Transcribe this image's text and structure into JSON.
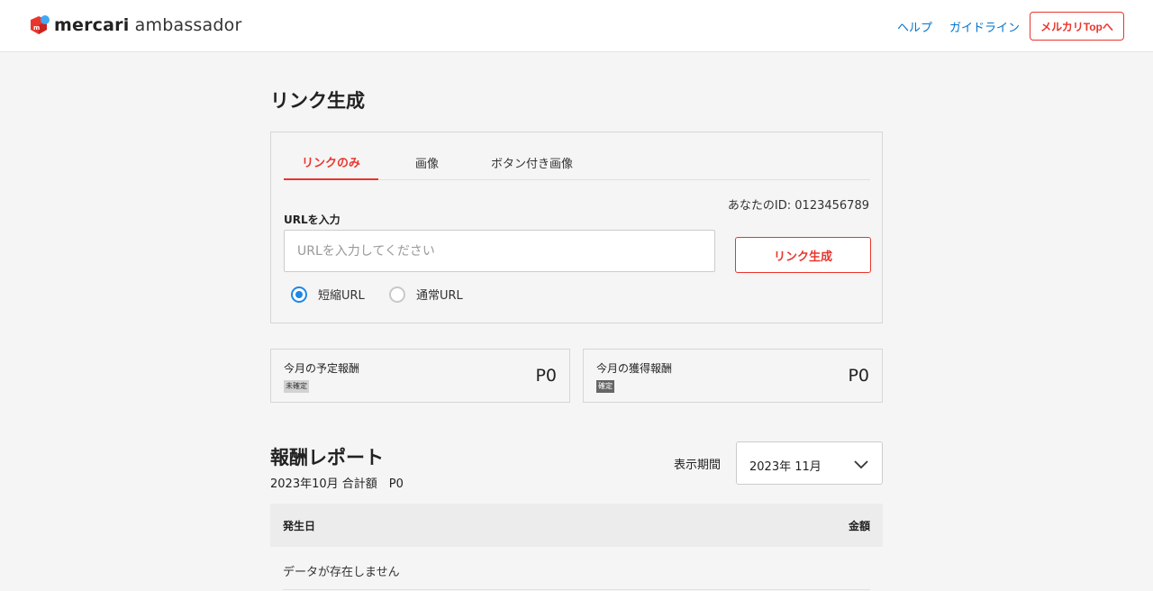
{
  "header": {
    "logo_bold": "mercari",
    "logo_light": "ambassador",
    "nav_help": "ヘルプ",
    "nav_guideline": "ガイドライン",
    "top_button": "メルカリTopへ",
    "brand_color": "#ea352d",
    "link_color": "#0073cc"
  },
  "page_title": "リンク生成",
  "link_panel": {
    "tabs": [
      {
        "label": "リンクのみ",
        "active": true
      },
      {
        "label": "画像",
        "active": false
      },
      {
        "label": "ボタン付き画像",
        "active": false
      }
    ],
    "user_id": "あなたのID: 0123456789",
    "url_label": "URLを入力",
    "url_value": "",
    "url_placeholder": "URLを入力してください",
    "generate_button": "リンク生成",
    "radio_options": [
      {
        "label": "短縮URL",
        "selected": true
      },
      {
        "label": "通常URL",
        "selected": false
      }
    ]
  },
  "rewards": {
    "scheduled": {
      "label": "今月の予定報酬",
      "badge": "未確定",
      "value": "P0"
    },
    "earned": {
      "label": "今月の獲得報酬",
      "badge": "確定",
      "value": "P0"
    }
  },
  "report": {
    "title": "報酬レポート",
    "summary": "2023年10月 合計額　P0",
    "period_label": "表示期間",
    "period_value": "2023年 11月",
    "columns": [
      "発生日",
      "金額"
    ],
    "empty_message": "データが存在しません"
  }
}
